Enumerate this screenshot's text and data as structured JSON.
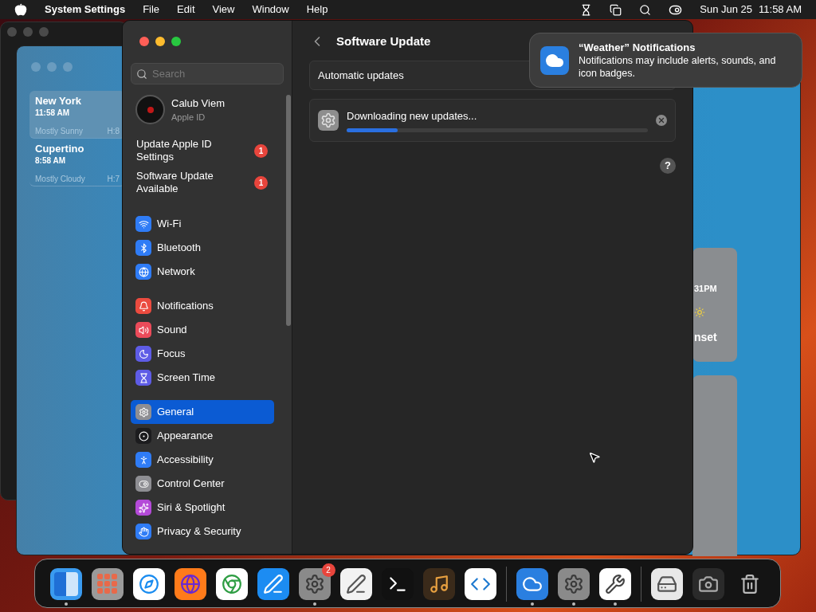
{
  "menu_bar": {
    "app_name": "System Settings",
    "menus": [
      "File",
      "Edit",
      "View",
      "Window",
      "Help"
    ],
    "date": "Sun Jun 25",
    "time": "11:58 AM"
  },
  "weather_window": {
    "locations": [
      {
        "city": "New York",
        "time": "11:58 AM",
        "condition": "Mostly Sunny",
        "high": "H:8",
        "selected": true
      },
      {
        "city": "Cupertino",
        "time": "8:58 AM",
        "condition": "Mostly Cloudy",
        "high": "H:7",
        "selected": false
      }
    ],
    "sunset_card": {
      "time": "31PM",
      "label": "nset"
    }
  },
  "settings_window": {
    "search": {
      "placeholder": "Search"
    },
    "account": {
      "name": "Calub Viem",
      "subtitle": "Apple ID"
    },
    "alerts": [
      {
        "label": "Update Apple ID Settings",
        "badge": "1"
      },
      {
        "label": "Software Update Available",
        "badge": "1"
      }
    ],
    "sidebar_groups": [
      [
        {
          "kind": "wifi",
          "label": "Wi-Fi",
          "color": "#2f7cf6",
          "selected": false
        },
        {
          "kind": "bluetooth",
          "label": "Bluetooth",
          "color": "#2f7cf6",
          "selected": false
        },
        {
          "kind": "network",
          "label": "Network",
          "color": "#2f7cf6",
          "selected": false
        }
      ],
      [
        {
          "kind": "notifications",
          "label": "Notifications",
          "color": "#eb4b3f",
          "selected": false
        },
        {
          "kind": "sound",
          "label": "Sound",
          "color": "#eb4b5a",
          "selected": false
        },
        {
          "kind": "focus",
          "label": "Focus",
          "color": "#5e5ce6",
          "selected": false
        },
        {
          "kind": "screentime",
          "label": "Screen Time",
          "color": "#5e5ce6",
          "selected": false
        }
      ],
      [
        {
          "kind": "general",
          "label": "General",
          "color": "#8e8e93",
          "selected": true
        },
        {
          "kind": "appearance",
          "label": "Appearance",
          "color": "#1c1c1e",
          "selected": false
        },
        {
          "kind": "accessibility",
          "label": "Accessibility",
          "color": "#2f7cf6",
          "selected": false
        },
        {
          "kind": "controlcenter",
          "label": "Control Center",
          "color": "#8e8e93",
          "selected": false
        },
        {
          "kind": "siri",
          "label": "Siri & Spotlight",
          "color": "#b44ad8",
          "selected": false
        },
        {
          "kind": "privacy",
          "label": "Privacy & Security",
          "color": "#2f7cf6",
          "selected": false
        }
      ]
    ],
    "page_title": "Software Update",
    "automatic_updates": "Automatic updates",
    "download": {
      "label": "Downloading new updates...",
      "level": 0.17
    },
    "help": "?"
  },
  "notification": {
    "title": "“Weather” Notifications",
    "body": "Notifications may include alerts, sounds, and icon badges."
  },
  "dock": {
    "groups": [
      [
        {
          "kind": "finder",
          "running": true
        },
        {
          "kind": "launchpad",
          "running": false
        },
        {
          "kind": "safari",
          "running": false
        },
        {
          "kind": "firefox",
          "running": false
        },
        {
          "kind": "chrome",
          "running": false
        },
        {
          "kind": "appstore",
          "running": false
        },
        {
          "kind": "settings",
          "running": true,
          "badge": "2"
        },
        {
          "kind": "textedit",
          "running": false
        },
        {
          "kind": "terminal",
          "running": false
        },
        {
          "kind": "garageband",
          "running": false
        },
        {
          "kind": "vscode",
          "running": false
        }
      ],
      [
        {
          "kind": "weather",
          "running": true
        },
        {
          "kind": "settings",
          "running": true
        },
        {
          "kind": "utility",
          "running": true
        }
      ],
      [
        {
          "kind": "disk",
          "running": false
        },
        {
          "kind": "screenshot",
          "running": false
        },
        {
          "kind": "trash",
          "running": false
        }
      ]
    ]
  }
}
